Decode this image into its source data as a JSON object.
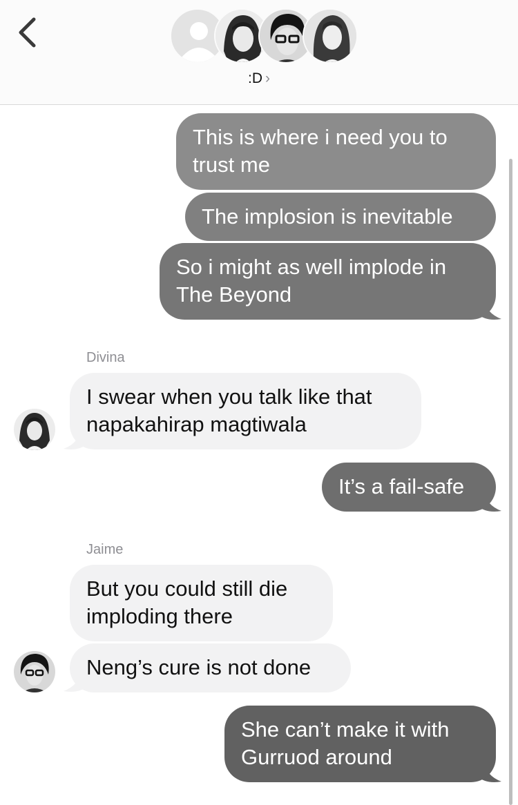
{
  "header": {
    "group_name": ":D",
    "chevron": "›"
  },
  "icons": {
    "back": "chevron-left-icon",
    "group_chevron": "chevron-right-icon",
    "placeholder_avatar": "person-silhouette-icon"
  },
  "colors": {
    "sent_light": "#8c8c8c",
    "sent_mid": "#7a7a7a",
    "sent_dark": "#656565",
    "received": "#f2f2f3",
    "meta_text": "#8e8e93"
  },
  "messages": [
    {
      "type": "sent",
      "lines": [
        "This is where i need you to",
        "trust me"
      ]
    },
    {
      "type": "sent",
      "lines": [
        "The implosion is inevitable"
      ]
    },
    {
      "type": "sent",
      "lines": [
        "So i might as well implode in",
        "The Beyond"
      ]
    },
    {
      "type": "sender",
      "name": "Divina"
    },
    {
      "type": "received",
      "lines": [
        "I swear when you talk like that",
        "napakahirap magtiwala"
      ]
    },
    {
      "type": "sent",
      "lines": [
        "It’s a fail-safe"
      ]
    },
    {
      "type": "sender",
      "name": "Jaime"
    },
    {
      "type": "received",
      "lines": [
        "But you could still die",
        "imploding there"
      ]
    },
    {
      "type": "received",
      "lines": [
        "Neng’s cure is not done"
      ]
    },
    {
      "type": "sent",
      "lines": [
        "She can’t make it with",
        "Gurruod around"
      ]
    }
  ]
}
